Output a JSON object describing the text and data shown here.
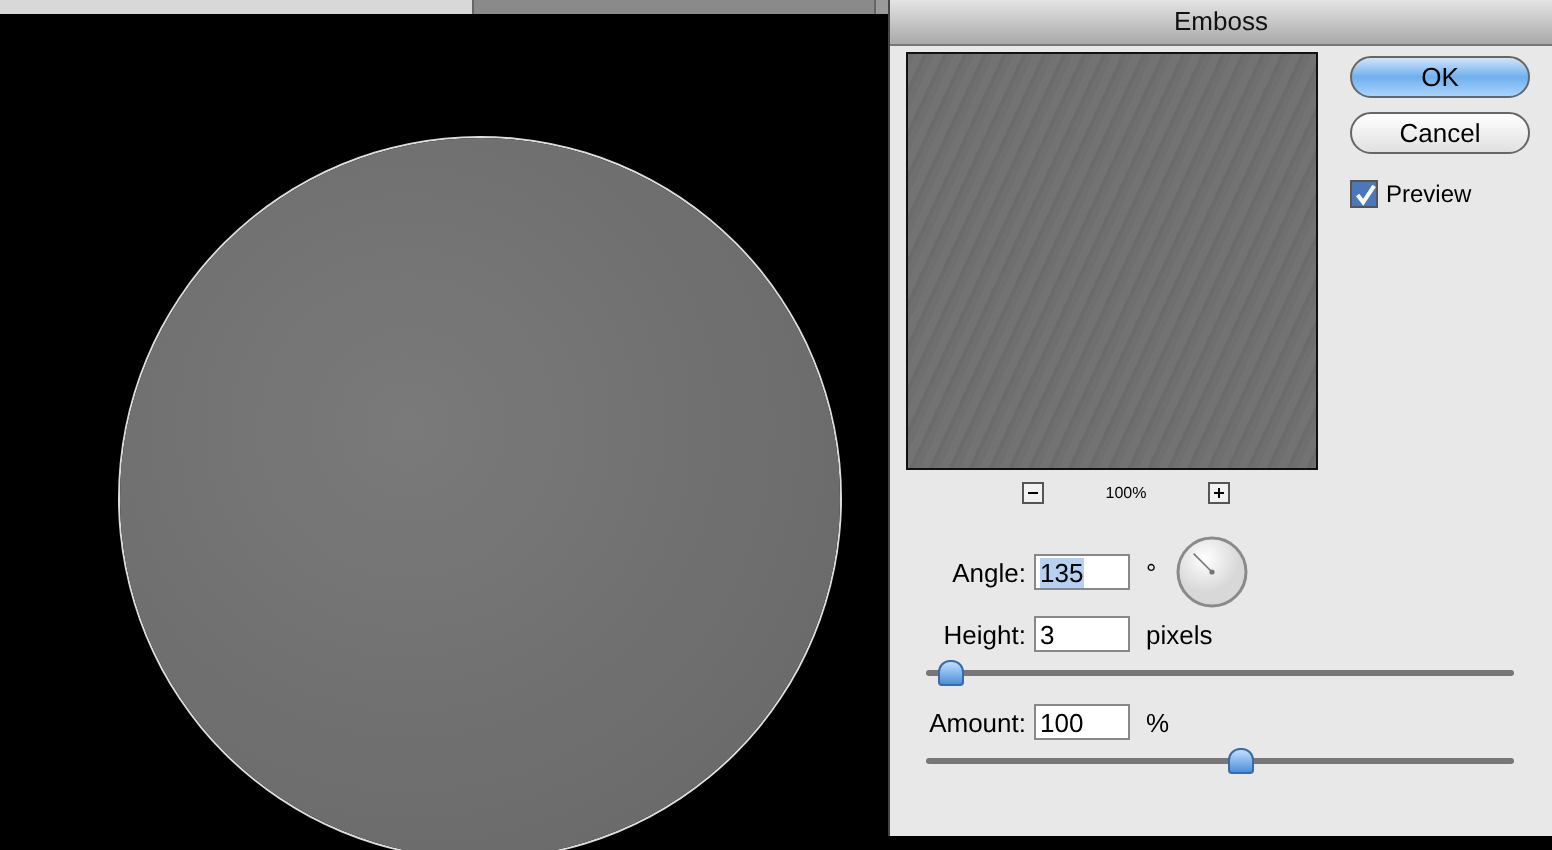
{
  "document_tabs": [
    {
      "selected": true
    },
    {
      "selected": false
    }
  ],
  "dialog": {
    "title": "Emboss",
    "buttons": [
      {
        "label": "OK",
        "default": true
      },
      {
        "label": "Cancel",
        "default": false
      }
    ],
    "preview": {
      "label": "Preview",
      "checked": true
    },
    "zoom": "100%",
    "angle": {
      "label": "Angle:",
      "value": "135",
      "unit": "°",
      "selected": true
    },
    "height": {
      "label": "Height:",
      "value": "3",
      "unit": "pixels",
      "level": 0.02
    },
    "amount": {
      "label": "Amount:",
      "value": "100",
      "unit": "%",
      "level": 0.54
    }
  }
}
